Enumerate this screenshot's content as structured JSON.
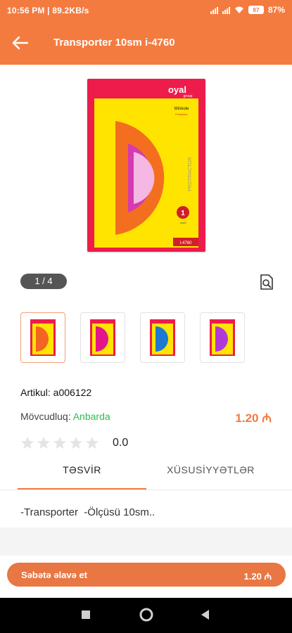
{
  "status_bar": {
    "time_info": "10:56 PM | 89.2KB/s",
    "battery": "87",
    "battery_pct": "87%"
  },
  "app_bar": {
    "title": "Transporter 10sm i-4760"
  },
  "gallery": {
    "counter": "1 / 4",
    "thumbnails": [
      {
        "color": "#f26522"
      },
      {
        "color": "#e4148a"
      },
      {
        "color": "#1f78d1"
      },
      {
        "color": "#b13ad6"
      }
    ],
    "hero": {
      "brand": "oyal",
      "brand_sub": "group",
      "card_title": "Minkole",
      "card_sub": "Protractor",
      "side_text": "PROTRACTOR",
      "count": "1",
      "count_label": "ədəd",
      "code": "I-4760"
    }
  },
  "product": {
    "artikul": "Artikul: a006122",
    "availability_label": "Mövcudluq:",
    "availability_value": "Anbarda",
    "price": "1.20 ₼",
    "rating": "0.0",
    "stars_filled": 0,
    "stars_total": 5
  },
  "tabs": {
    "description": "TƏSVİR",
    "specs": "XÜSUSİYYƏTLƏR"
  },
  "description": "-Transporter  -Ölçüsü 10sm..",
  "cart": {
    "label": "Səbətə əlavə et",
    "price": "1.20 ₼"
  },
  "colors": {
    "accent": "#f47b3f",
    "available": "#2ebd4d"
  }
}
